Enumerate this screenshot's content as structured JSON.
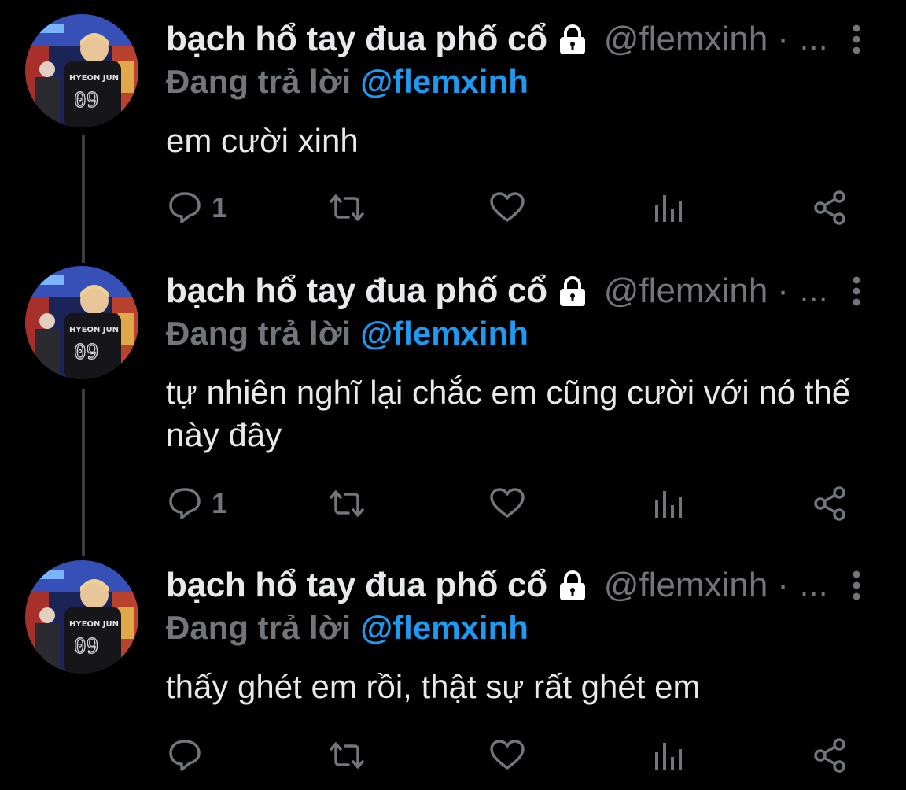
{
  "colors": {
    "background": "#000000",
    "text": "#e7e9ea",
    "muted": "#71767b",
    "accent": "#1d9bf0",
    "thread_line": "#3a3d40"
  },
  "tweets": [
    {
      "display_name": "bạch hổ tay đua phố cổ",
      "handle": "@flemxinh",
      "separator": "·",
      "truncated": "...",
      "reply_prefix": "Đang trả lời",
      "reply_to": "@flemxinh",
      "text": "em cười xinh",
      "reply_count": "1",
      "icons": [
        "reply-icon",
        "retweet-icon",
        "like-icon",
        "views-icon",
        "share-icon"
      ]
    },
    {
      "display_name": "bạch hổ tay đua phố cổ",
      "handle": "@flemxinh",
      "separator": "·",
      "truncated": "...",
      "reply_prefix": "Đang trả lời",
      "reply_to": "@flemxinh",
      "text": "tự nhiên nghĩ lại chắc em cũng cười với nó thế này đây",
      "reply_count": "1",
      "icons": [
        "reply-icon",
        "retweet-icon",
        "like-icon",
        "views-icon",
        "share-icon"
      ]
    },
    {
      "display_name": "bạch hổ tay đua phố cổ",
      "handle": "@flemxinh",
      "separator": "·",
      "truncated": "...",
      "reply_prefix": "Đang trả lời",
      "reply_to": "@flemxinh",
      "text": "thấy ghét em rồi, thật sự rất ghét em",
      "reply_count": "",
      "icons": [
        "reply-icon",
        "retweet-icon",
        "like-icon",
        "views-icon",
        "share-icon"
      ]
    }
  ]
}
